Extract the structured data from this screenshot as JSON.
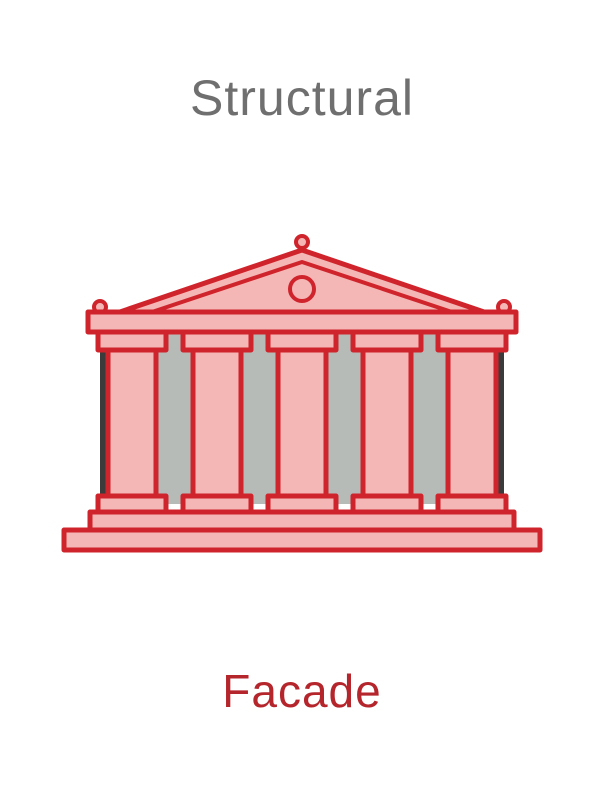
{
  "heading": "Structural",
  "caption": "Facade",
  "icon": "classical-building-facade-icon",
  "colors": {
    "heading_text": "#6f6f6f",
    "caption_text": "#b5262c",
    "outline": "#d0242c",
    "fill_light": "#f5b6b6",
    "column_gap": "#b7bbb8",
    "shadow": "#3b3b3b"
  }
}
